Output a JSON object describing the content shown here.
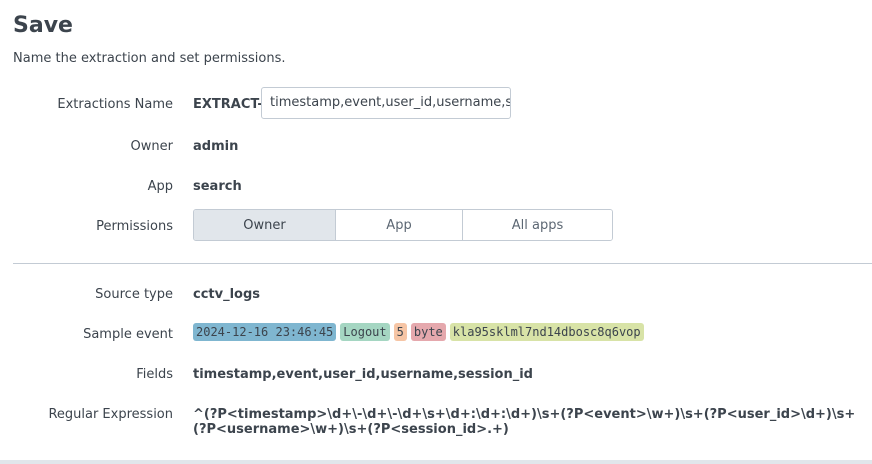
{
  "header": {
    "title": "Save",
    "subtitle": "Name the extraction and set permissions."
  },
  "form": {
    "extraction_name": {
      "label": "Extractions Name",
      "prefix": "EXTRACT-",
      "value": "timestamp,event,user_id,username,se"
    },
    "owner": {
      "label": "Owner",
      "value": "admin"
    },
    "app": {
      "label": "App",
      "value": "search"
    },
    "permissions": {
      "label": "Permissions",
      "options": [
        "Owner",
        "App",
        "All apps"
      ],
      "selected": "Owner"
    }
  },
  "details": {
    "source_type": {
      "label": "Source type",
      "value": "cctv_logs"
    },
    "sample_event": {
      "label": "Sample event",
      "tokens": [
        {
          "text": "2024-12-16 23:46:45",
          "color": "#7fb6d0"
        },
        {
          "text": "Logout",
          "color": "#a5d6c2"
        },
        {
          "text": "5",
          "color": "#f6c5a5"
        },
        {
          "text": "byte",
          "color": "#e5a8ad"
        },
        {
          "text": "kla95sklml7nd14dbosc8q6vop",
          "color": "#d8e3a7"
        }
      ]
    },
    "fields": {
      "label": "Fields",
      "value": "timestamp,event,user_id,username,session_id"
    },
    "regex": {
      "label": "Regular Expression",
      "value": "^(?P<timestamp>\\d+\\-\\d+\\-\\d+\\s+\\d+:\\d+:\\d+)\\s+(?P<event>\\w+)\\s+(?P<user_id>\\d+)\\s+(?P<username>\\w+)\\s+(?P<session_id>.+)"
    }
  }
}
